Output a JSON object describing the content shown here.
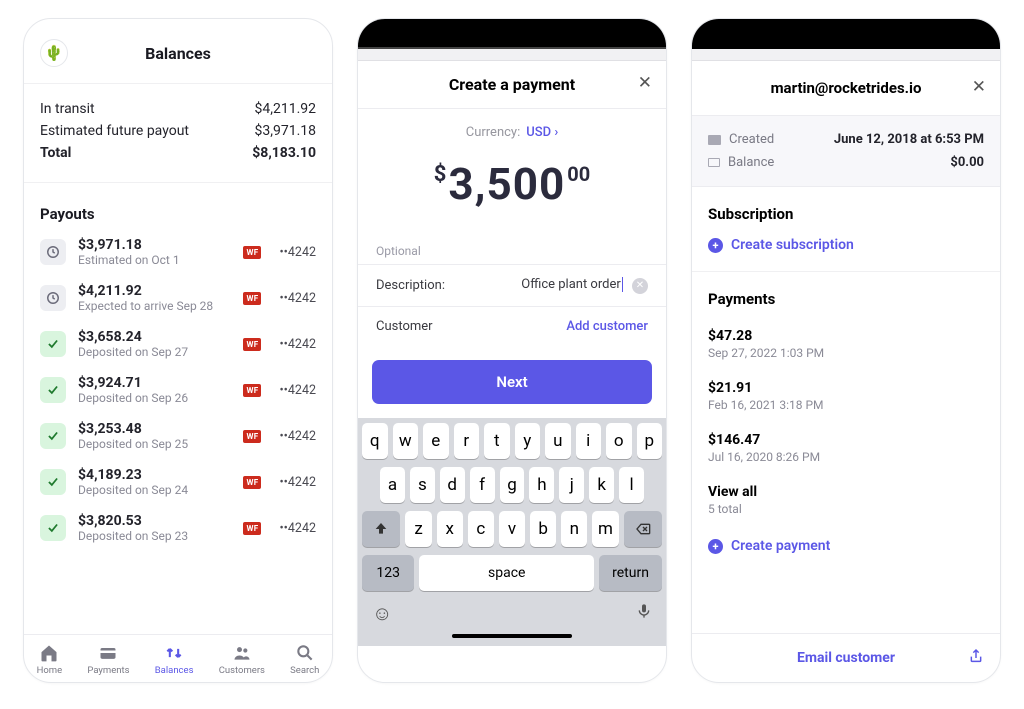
{
  "screen1": {
    "title": "Balances",
    "summary": {
      "in_transit_label": "In transit",
      "in_transit_value": "$4,211.92",
      "future_label": "Estimated future payout",
      "future_value": "$3,971.18",
      "total_label": "Total",
      "total_value": "$8,183.10"
    },
    "payouts_title": "Payouts",
    "payouts": [
      {
        "amount": "$3,971.18",
        "sub": "Estimated on Oct 1",
        "status": "clock",
        "last4": "••4242"
      },
      {
        "amount": "$4,211.92",
        "sub": "Expected to arrive Sep 28",
        "status": "clock",
        "last4": "••4242"
      },
      {
        "amount": "$3,658.24",
        "sub": "Deposited on Sep 27",
        "status": "check",
        "last4": "••4242"
      },
      {
        "amount": "$3,924.71",
        "sub": "Deposited on Sep 26",
        "status": "check",
        "last4": "••4242"
      },
      {
        "amount": "$3,253.48",
        "sub": "Deposited on Sep 25",
        "status": "check",
        "last4": "••4242"
      },
      {
        "amount": "$4,189.23",
        "sub": "Deposited on Sep 24",
        "status": "check",
        "last4": "••4242"
      },
      {
        "amount": "$3,820.53",
        "sub": "Deposited on Sep 23",
        "status": "check",
        "last4": "••4242"
      }
    ],
    "tabs": {
      "home": "Home",
      "payments": "Payments",
      "balances": "Balances",
      "customers": "Customers",
      "search": "Search"
    }
  },
  "screen2": {
    "title": "Create a payment",
    "currency_label": "Currency:",
    "currency_value": "USD",
    "amount_symbol": "$",
    "amount_main": "3,500",
    "amount_cents": "00",
    "optional_label": "Optional",
    "description_label": "Description:",
    "description_value": "Office plant order",
    "customer_label": "Customer",
    "add_customer": "Add customer",
    "next_button": "Next",
    "keyboard": {
      "row1": [
        "q",
        "w",
        "e",
        "r",
        "t",
        "y",
        "u",
        "i",
        "o",
        "p"
      ],
      "row2": [
        "a",
        "s",
        "d",
        "f",
        "g",
        "h",
        "j",
        "k",
        "l"
      ],
      "row3": [
        "z",
        "x",
        "c",
        "v",
        "b",
        "n",
        "m"
      ],
      "num": "123",
      "space": "space",
      "return": "return"
    }
  },
  "screen3": {
    "email": "martin@rocketrides.io",
    "created_label": "Created",
    "created_value": "June 12, 2018 at 6:53 PM",
    "balance_label": "Balance",
    "balance_value": "$0.00",
    "subscription_title": "Subscription",
    "create_subscription": "Create subscription",
    "payments_title": "Payments",
    "payments": [
      {
        "amount": "$47.28",
        "date": "Sep 27, 2022 1:03 PM"
      },
      {
        "amount": "$21.91",
        "date": "Feb 16, 2021 3:18 PM"
      },
      {
        "amount": "$146.47",
        "date": "Jul 16, 2020 8:26 PM"
      }
    ],
    "view_all": "View all",
    "view_all_sub": "5 total",
    "create_payment": "Create payment",
    "email_customer": "Email customer"
  }
}
